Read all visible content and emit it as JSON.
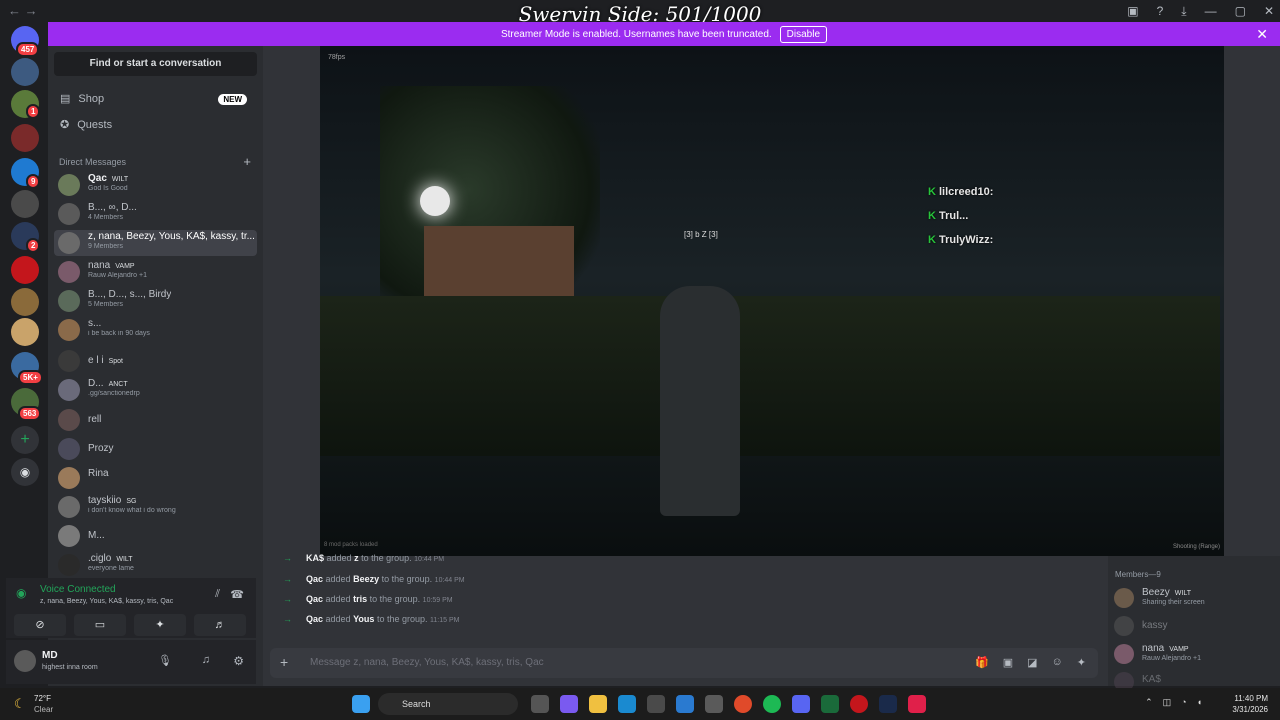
{
  "window": {
    "overlay_title": "Swervin Side: 501/1000",
    "title": "Direct Messages"
  },
  "banner": {
    "text": "Streamer Mode is enabled. Usernames have been truncated.",
    "button": "Disable"
  },
  "guild_badges": [
    "457",
    "1",
    "9",
    "2",
    "5K+",
    "563"
  ],
  "sidebar": {
    "find": "Find or start a conversation",
    "shop": "Shop",
    "shop_tag": "NEW",
    "quests": "Quests",
    "dm_header": "Direct Messages",
    "dms": [
      {
        "name": "Qac",
        "tag": "WILT",
        "sub": "God Is Good"
      },
      {
        "name": "B..., ∞, D...",
        "sub": "4 Members"
      },
      {
        "name": "z, nana, Beezy, Yous, KA$, kassy, tr...",
        "sub": "9 Members"
      },
      {
        "name": "nana",
        "tag": "VAMP",
        "sub": "Rauw Alejandro +1"
      },
      {
        "name": "B..., D..., s..., Birdy",
        "sub": "5 Members"
      },
      {
        "name": "s...",
        "sub": "i be back in 90 days"
      },
      {
        "name": "e l i",
        "tag": "Spot",
        "sub": ""
      },
      {
        "name": "D...",
        "tag": "ANCT",
        "sub": ".gg/sanctionedrp"
      },
      {
        "name": "rell",
        "sub": ""
      },
      {
        "name": "Prozy",
        "sub": ""
      },
      {
        "name": "Rina",
        "sub": ""
      },
      {
        "name": "tayskiio",
        "tag": "SG",
        "sub": "i don't know what i do wrong"
      },
      {
        "name": "M...",
        "sub": ""
      },
      {
        "name": ".ciglo",
        "tag": "WILT",
        "sub": "everyone lame"
      }
    ]
  },
  "voice": {
    "title": "Voice Connected",
    "members": "z, nana, Beezy, Yous, KA$, kassy, tris, Qac"
  },
  "user": {
    "name": "MD",
    "status": "highest inna room"
  },
  "stream": {
    "fps": "78fps",
    "center_tag": "[3] b  Z [3]",
    "killfeed": [
      "lilcreed10:",
      "Trul...",
      "TrulyWizz:"
    ],
    "bottom_left": "8 mod packs loaded",
    "bottom_right": "Shooting (Range)"
  },
  "messages": [
    {
      "actor": "KA$",
      "verb": "added",
      "target": "z",
      "rest": "to the group.",
      "time": "10:44 PM"
    },
    {
      "actor": "Qac",
      "verb": "added",
      "target": "Beezy",
      "rest": "to the group.",
      "time": "10:44 PM"
    },
    {
      "actor": "Qac",
      "verb": "added",
      "target": "tris",
      "rest": "to the group.",
      "time": "10:59 PM"
    },
    {
      "actor": "Qac",
      "verb": "added",
      "target": "Yous",
      "rest": "to the group.",
      "time": "11:15 PM"
    }
  ],
  "composer": {
    "placeholder": "Message z, nana, Beezy, Yous, KA$, kassy, tris, Qac"
  },
  "members": {
    "header": "Members—9",
    "list": [
      {
        "name": "Beezy",
        "tag": "WILT",
        "sub": "Sharing their screen"
      },
      {
        "name": "kassy",
        "sub": ""
      },
      {
        "name": "nana",
        "tag": "VAMP",
        "sub": "Rauw Alejandro +1"
      },
      {
        "name": "KA$",
        "sub": ""
      }
    ]
  },
  "taskbar": {
    "temp": "72°F",
    "condition": "Clear",
    "search": "Search",
    "time": "11:40 PM",
    "date": "3/31/2026"
  },
  "colors": {
    "accent": "#9b2cf0",
    "online": "#23a55a",
    "badge": "#f23f43"
  }
}
